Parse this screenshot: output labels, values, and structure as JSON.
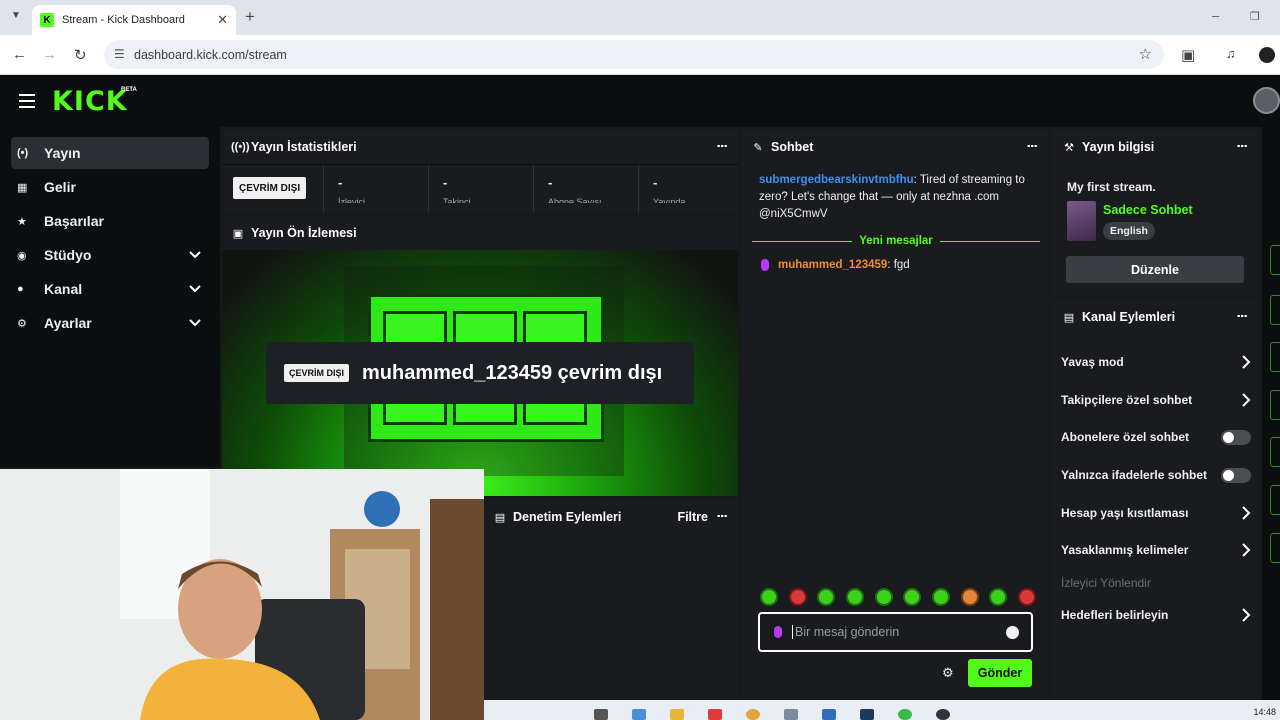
{
  "browser": {
    "tab_title": "Stream - Kick Dashboard",
    "url": "dashboard.kick.com/stream"
  },
  "brand": {
    "logo": "KICK",
    "badge": "BETA",
    "accent": "#53fc18"
  },
  "sidebar": {
    "items": [
      {
        "label": "Yayın",
        "icon": "broadcast-icon",
        "active": true,
        "expandable": false
      },
      {
        "label": "Gelir",
        "icon": "chart-icon",
        "active": false,
        "expandable": false
      },
      {
        "label": "Başarılar",
        "icon": "trophy-icon",
        "active": false,
        "expandable": true
      },
      {
        "label": "Stüdyo",
        "icon": "camera-icon",
        "active": false,
        "expandable": true
      },
      {
        "label": "Kanal",
        "icon": "users-icon",
        "active": false,
        "expandable": true
      },
      {
        "label": "Ayarlar",
        "icon": "gear-icon",
        "active": false,
        "expandable": true
      }
    ]
  },
  "stats": {
    "title": "Yayın İstatistikleri",
    "status_button": "ÇEVRİM DIŞI",
    "cells": [
      {
        "value": "-",
        "label": "İzleyici"
      },
      {
        "value": "-",
        "label": "Takipçi"
      },
      {
        "value": "-",
        "label": "Abone Sayısı"
      },
      {
        "value": "-",
        "label": "Yayında"
      }
    ]
  },
  "preview": {
    "title": "Yayın Ön İzlemesi",
    "badge": "ÇEVRİM DIŞI",
    "offline_text": "muhammed_123459 çevrim dışı"
  },
  "moderation": {
    "title": "Denetim Eylemleri",
    "filter": "Filtre"
  },
  "chat": {
    "title": "Sohbet",
    "messages": [
      {
        "user": "submergedbearskinvtmbfhu",
        "text": ": Tired of streaming to zero? Let's change that — only at nezhna .com @niX5CmwV"
      },
      {
        "user": "muhammed_123459",
        "text": ": fgd"
      }
    ],
    "new_messages_label": "Yeni mesajlar",
    "input_placeholder": "Bir mesaj gönderin",
    "send_label": "Gönder"
  },
  "stream_info": {
    "title": "Yayın bilgisi",
    "stream_title": "My first stream.",
    "category": "Sadece Sohbet",
    "language": "English",
    "edit_label": "Düzenle"
  },
  "channel_actions": {
    "title": "Kanal Eylemleri",
    "rows": [
      {
        "label": "Yavaş mod",
        "control": "chevron"
      },
      {
        "label": "Takipçilere özel sohbet",
        "control": "chevron"
      },
      {
        "label": "Abonelere özel sohbet",
        "control": "toggle",
        "on": false
      },
      {
        "label": "Yalnızca ifadelerle sohbet",
        "control": "toggle",
        "on": false
      },
      {
        "label": "Hesap yaşı kısıtlaması",
        "control": "chevron"
      },
      {
        "label": "Yasaklanmış kelimeler",
        "control": "chevron"
      },
      {
        "label": "İzleyici Yönlendir",
        "control": "none"
      },
      {
        "label": "Hedefleri belirleyin",
        "control": "chevron"
      }
    ]
  },
  "taskbar": {
    "clock": "14:48"
  }
}
